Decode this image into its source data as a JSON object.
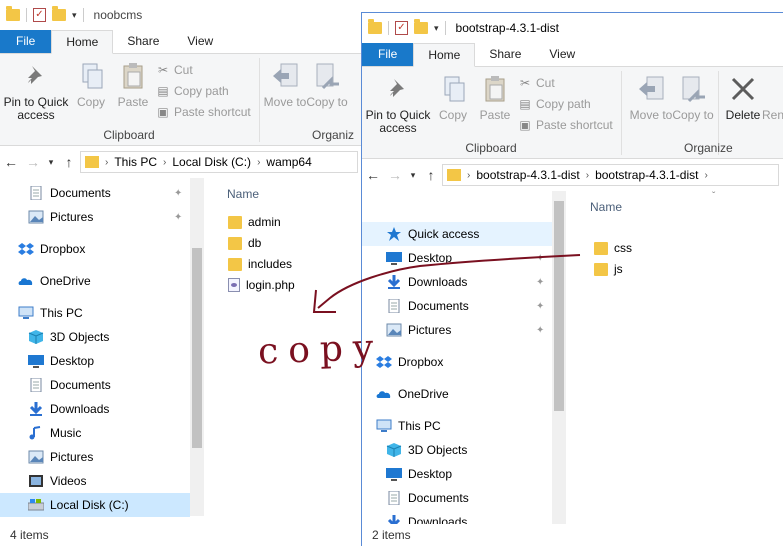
{
  "window_left": {
    "title": "noobcms",
    "tabs": [
      "File",
      "Home",
      "Share",
      "View"
    ],
    "ribbon": {
      "pin_label": "Pin to Quick access",
      "copy_label": "Copy",
      "paste_label": "Paste",
      "cut_label": "Cut",
      "copy_path_label": "Copy path",
      "paste_shortcut_label": "Paste shortcut",
      "clipboard_group": "Clipboard",
      "move_to_label": "Move to",
      "copy_to_label": "Copy to",
      "organize_group": "Organiz"
    },
    "address": [
      "This PC",
      "Local Disk (C:)",
      "wamp64"
    ],
    "nav": [
      {
        "label": "Documents",
        "icon": "documents-icon",
        "pinned": true
      },
      {
        "label": "Pictures",
        "icon": "pictures-icon",
        "pinned": true
      },
      {
        "label": "Dropbox",
        "icon": "dropbox-icon",
        "pinned": false
      },
      {
        "label": "OneDrive",
        "icon": "onedrive-icon",
        "pinned": false
      },
      {
        "label": "This PC",
        "icon": "this-pc-icon",
        "pinned": false
      },
      {
        "label": "3D Objects",
        "icon": "3d-objects-icon",
        "pinned": false
      },
      {
        "label": "Desktop",
        "icon": "desktop-icon",
        "pinned": false
      },
      {
        "label": "Documents",
        "icon": "documents-icon",
        "pinned": false
      },
      {
        "label": "Downloads",
        "icon": "downloads-icon",
        "pinned": false
      },
      {
        "label": "Music",
        "icon": "music-icon",
        "pinned": false
      },
      {
        "label": "Pictures",
        "icon": "pictures-icon",
        "pinned": false
      },
      {
        "label": "Videos",
        "icon": "videos-icon",
        "pinned": false
      },
      {
        "label": "Local Disk (C:)",
        "icon": "local-disk-icon",
        "pinned": false
      }
    ],
    "column_name": "Name",
    "files": [
      {
        "name": "admin",
        "type": "folder"
      },
      {
        "name": "db",
        "type": "folder"
      },
      {
        "name": "includes",
        "type": "folder"
      },
      {
        "name": "login.php",
        "type": "php"
      }
    ],
    "status": "4 items"
  },
  "window_right": {
    "title": "bootstrap-4.3.1-dist",
    "tabs": [
      "File",
      "Home",
      "Share",
      "View"
    ],
    "ribbon": {
      "pin_label": "Pin to Quick access",
      "copy_label": "Copy",
      "paste_label": "Paste",
      "cut_label": "Cut",
      "copy_path_label": "Copy path",
      "paste_shortcut_label": "Paste shortcut",
      "clipboard_group": "Clipboard",
      "move_to_label": "Move to",
      "copy_to_label": "Copy to",
      "delete_label": "Delete",
      "rename_label": "Ren",
      "organize_group": "Organize"
    },
    "address": [
      "bootstrap-4.3.1-dist",
      "bootstrap-4.3.1-dist"
    ],
    "nav": [
      {
        "label": "Quick access",
        "icon": "star-icon",
        "pinned": false
      },
      {
        "label": "Desktop",
        "icon": "desktop-icon",
        "pinned": true
      },
      {
        "label": "Downloads",
        "icon": "downloads-icon",
        "pinned": true
      },
      {
        "label": "Documents",
        "icon": "documents-icon",
        "pinned": true
      },
      {
        "label": "Pictures",
        "icon": "pictures-icon",
        "pinned": true
      },
      {
        "label": "Dropbox",
        "icon": "dropbox-icon",
        "pinned": false
      },
      {
        "label": "OneDrive",
        "icon": "onedrive-icon",
        "pinned": false
      },
      {
        "label": "This PC",
        "icon": "this-pc-icon",
        "pinned": false
      },
      {
        "label": "3D Objects",
        "icon": "3d-objects-icon",
        "pinned": false
      },
      {
        "label": "Desktop",
        "icon": "desktop-icon",
        "pinned": false
      },
      {
        "label": "Documents",
        "icon": "documents-icon",
        "pinned": false
      },
      {
        "label": "Downloads",
        "icon": "downloads-icon",
        "pinned": false
      }
    ],
    "column_name": "Name",
    "files": [
      {
        "name": "css",
        "type": "folder"
      },
      {
        "name": "js",
        "type": "folder"
      }
    ],
    "status": "2 items"
  },
  "annotation": {
    "text": "copy",
    "color": "#7a1020"
  },
  "colors": {
    "file_tab": "#1979ca",
    "selected": "#cce8ff",
    "folder": "#f3c646"
  }
}
